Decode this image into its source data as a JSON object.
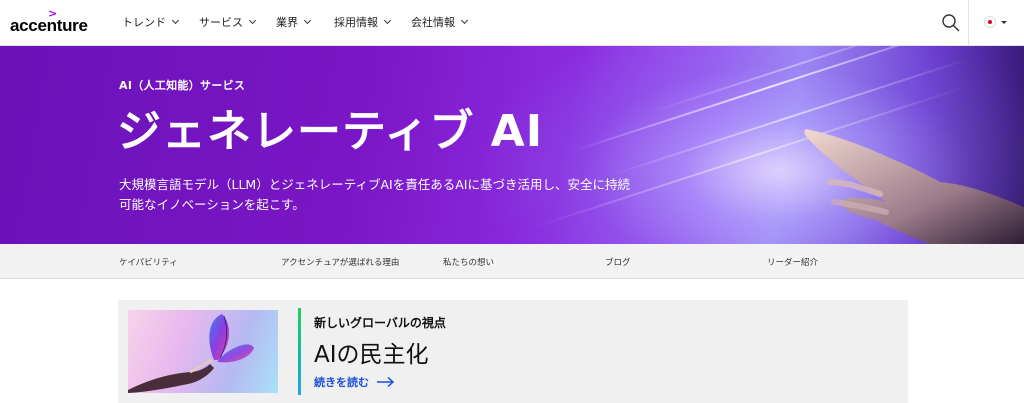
{
  "brand": {
    "logo_text": "accenture",
    "logo_mark": ">"
  },
  "nav": {
    "items": [
      {
        "label": "トレンド"
      },
      {
        "label": "サービス"
      },
      {
        "label": "業界"
      },
      {
        "label": "採用情報"
      },
      {
        "label": "会社情報"
      }
    ],
    "search_icon": "search-icon",
    "language_icon": "japan-flag-icon"
  },
  "hero": {
    "eyebrow": "AI（人工知能）サービス",
    "title": "ジェネレーティブ AI",
    "description": "大規模言語モデル（LLM）とジェネレーティブAIを責任あるAIに基づき活用し、安全に持続可能なイノベーションを起こす。"
  },
  "subnav": {
    "items": [
      {
        "label": "ケイパビリティ"
      },
      {
        "label": "アクセンチュアが選ばれる理由"
      },
      {
        "label": "私たちの想い"
      },
      {
        "label": "ブログ"
      },
      {
        "label": "リーダー紹介"
      }
    ]
  },
  "featured": {
    "kicker": "新しいグローバルの視点",
    "title": "AIの民主化",
    "cta": "続きを読む",
    "cta_icon": "arrow-right-icon"
  },
  "colors": {
    "brand_purple": "#a100ff",
    "hero_purple": "#7a16c6",
    "link_blue": "#1d4fd8",
    "accent_green": "#1fd15a",
    "accent_cyan": "#1ea7e6"
  }
}
